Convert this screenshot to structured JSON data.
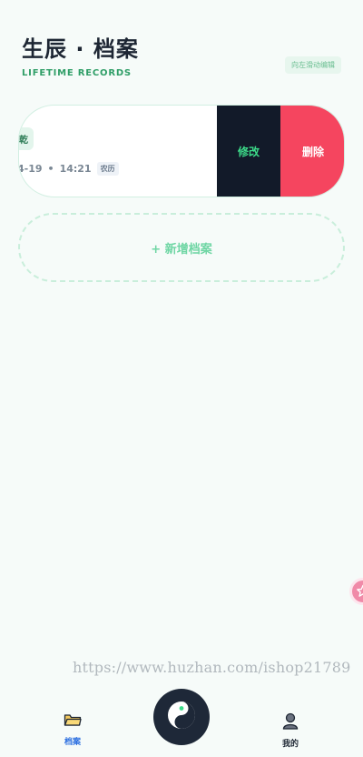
{
  "header": {
    "title": "生辰 · 档案",
    "subtitle": "LIFETIME RECORDS",
    "swipe_hint": "向左滑动编辑"
  },
  "record": {
    "tag": "乾",
    "date": "4-19",
    "separator": "•",
    "time": "14:21",
    "calendar_badge": "农历",
    "edit_label": "修改",
    "delete_label": "删除"
  },
  "add_button": {
    "label": "+ 新增档案"
  },
  "watermark": "https://www.huzhan.com/ishop21789",
  "tabbar": {
    "archive_label": "档案",
    "me_label": "我的"
  },
  "icons": {
    "archive": "folder-icon",
    "me": "user-icon",
    "center": "yin-yang-icon",
    "float": "star-badge-icon"
  },
  "colors": {
    "accent_green": "#3ddc8a",
    "delete_red": "#f5455f",
    "edit_dark": "#121a29",
    "tab_active_blue": "#2c6fe0",
    "background": "#f6fbf9"
  }
}
